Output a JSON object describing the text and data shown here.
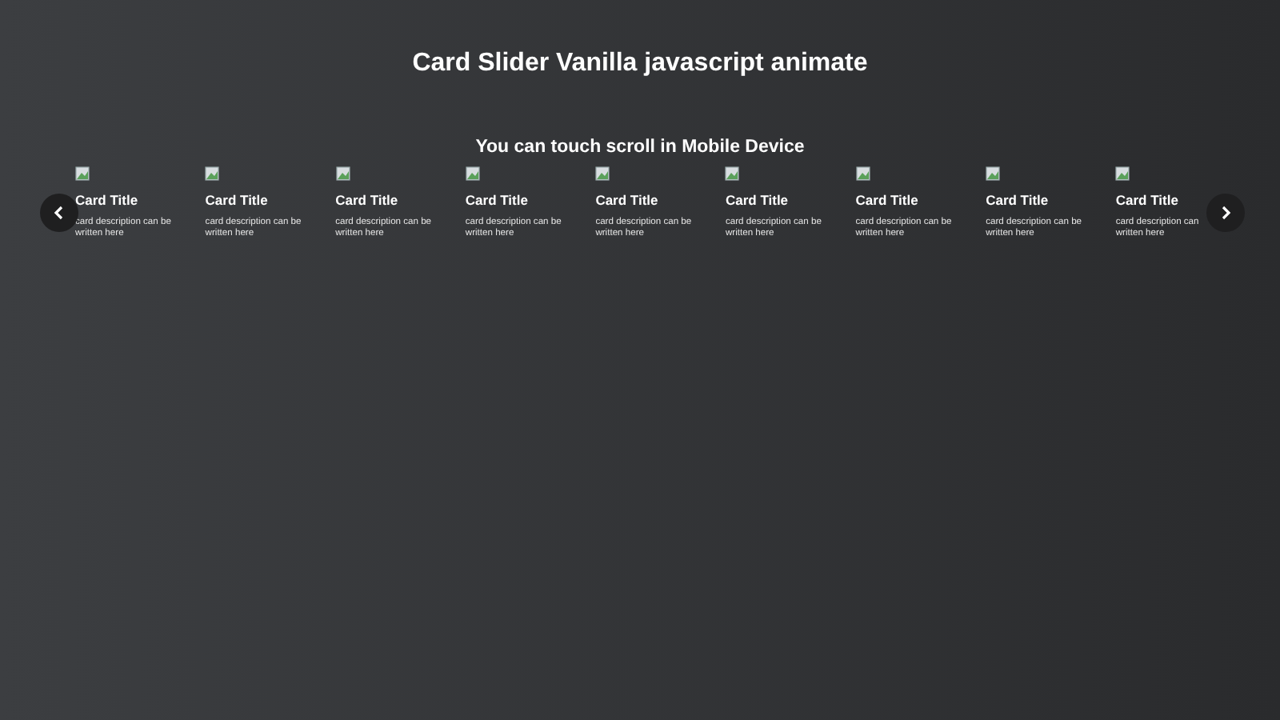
{
  "title": "Card Slider Vanilla javascript animate",
  "subtitle": "You can touch scroll in Mobile Device",
  "cards": [
    {
      "title": "Card Title",
      "description": [
        "card description can be",
        "written here"
      ]
    },
    {
      "title": "Card Title",
      "description": [
        "card description can be",
        "written here"
      ]
    },
    {
      "title": "Card Title",
      "description": [
        "card description can be",
        "written here"
      ]
    },
    {
      "title": "Card Title",
      "description": [
        "card description can be",
        "written here"
      ]
    },
    {
      "title": "Card Title",
      "description": [
        "card description can be",
        "written here"
      ]
    },
    {
      "title": "Card Title",
      "description": [
        "card description can be",
        "written here"
      ]
    },
    {
      "title": "Card Title",
      "description": [
        "card description can be",
        "written here"
      ]
    },
    {
      "title": "Card Title",
      "description": [
        "card description can be",
        "written here"
      ]
    },
    {
      "title": "Card Title",
      "description": [
        "card description can",
        "written here"
      ]
    }
  ]
}
